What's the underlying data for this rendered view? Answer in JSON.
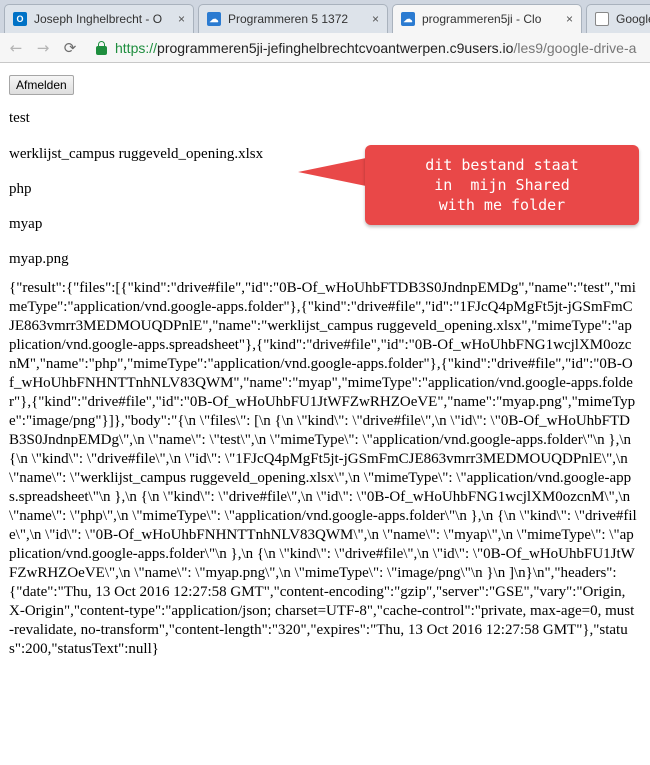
{
  "browser": {
    "tabs": [
      {
        "title": "Joseph Inghelbrecht - O",
        "icon": "outlook-icon",
        "color": "#0072c6",
        "active": false
      },
      {
        "title": "Programmeren 5 1372",
        "icon": "cloud9-icon",
        "color": "#2b7bd1",
        "active": false
      },
      {
        "title": "programmeren5ji - Clo",
        "icon": "cloud9-icon",
        "color": "#2b7bd1",
        "active": true
      },
      {
        "title": "Google D",
        "icon": "document-icon",
        "color": "#888888",
        "active": false
      }
    ],
    "close_glyph": "×",
    "url": {
      "scheme": "https://",
      "host": "programmeren5ji-jefinghelbrechtcvoantwerpen.c9users.io",
      "path": "/les9/google-drive-a"
    }
  },
  "page": {
    "logout_label": "Afmelden",
    "files": [
      "test",
      "werklijst_campus ruggeveld_opening.xlsx",
      "php",
      "myap",
      "myap.png"
    ],
    "callout_text": "dit bestand staat\nin  mijn Shared\nwith me folder",
    "callout_color": "#e94848",
    "json_output": "{\"result\":{\"files\":[{\"kind\":\"drive#file\",\"id\":\"0B-Of_wHoUhbFTDB3S0JndnpEMDg\",\"name\":\"test\",\"mimeType\":\"application/vnd.google-apps.folder\"},{\"kind\":\"drive#file\",\"id\":\"1FJcQ4pMgFt5jt-jGSmFmCJE863vmrr3MEDMOUQDPnlE\",\"name\":\"werklijst_campus ruggeveld_opening.xlsx\",\"mimeType\":\"application/vnd.google-apps.spreadsheet\"},{\"kind\":\"drive#file\",\"id\":\"0B-Of_wHoUhbFNG1wcjlXM0ozcnM\",\"name\":\"php\",\"mimeType\":\"application/vnd.google-apps.folder\"},{\"kind\":\"drive#file\",\"id\":\"0B-Of_wHoUhbFNHNTTnhNLV83QWM\",\"name\":\"myap\",\"mimeType\":\"application/vnd.google-apps.folder\"},{\"kind\":\"drive#file\",\"id\":\"0B-Of_wHoUhbFU1JtWFZwRHZOeVE\",\"name\":\"myap.png\",\"mimeType\":\"image/png\"}]},\"body\":\"{\\n \\\"files\\\": [\\n {\\n \\\"kind\\\": \\\"drive#file\\\",\\n \\\"id\\\": \\\"0B-Of_wHoUhbFTDB3S0JndnpEMDg\\\",\\n \\\"name\\\": \\\"test\\\",\\n \\\"mimeType\\\": \\\"application/vnd.google-apps.folder\\\"\\n },\\n {\\n \\\"kind\\\": \\\"drive#file\\\",\\n \\\"id\\\": \\\"1FJcQ4pMgFt5jt-jGSmFmCJE863vmrr3MEDMOUQDPnlE\\\",\\n \\\"name\\\": \\\"werklijst_campus ruggeveld_opening.xlsx\\\",\\n \\\"mimeType\\\": \\\"application/vnd.google-apps.spreadsheet\\\"\\n },\\n {\\n \\\"kind\\\": \\\"drive#file\\\",\\n \\\"id\\\": \\\"0B-Of_wHoUhbFNG1wcjlXM0ozcnM\\\",\\n \\\"name\\\": \\\"php\\\",\\n \\\"mimeType\\\": \\\"application/vnd.google-apps.folder\\\"\\n },\\n {\\n \\\"kind\\\": \\\"drive#file\\\",\\n \\\"id\\\": \\\"0B-Of_wHoUhbFNHNTTnhNLV83QWM\\\",\\n \\\"name\\\": \\\"myap\\\",\\n \\\"mimeType\\\": \\\"application/vnd.google-apps.folder\\\"\\n },\\n {\\n \\\"kind\\\": \\\"drive#file\\\",\\n \\\"id\\\": \\\"0B-Of_wHoUhbFU1JtWFZwRHZOeVE\\\",\\n \\\"name\\\": \\\"myap.png\\\",\\n \\\"mimeType\\\": \\\"image/png\\\"\\n }\\n ]\\n}\\n\",\"headers\":{\"date\":\"Thu, 13 Oct 2016 12:27:58 GMT\",\"content-encoding\":\"gzip\",\"server\":\"GSE\",\"vary\":\"Origin, X-Origin\",\"content-type\":\"application/json; charset=UTF-8\",\"cache-control\":\"private, max-age=0, must-revalidate, no-transform\",\"content-length\":\"320\",\"expires\":\"Thu, 13 Oct 2016 12:27:58 GMT\"},\"status\":200,\"statusText\":null}"
  }
}
